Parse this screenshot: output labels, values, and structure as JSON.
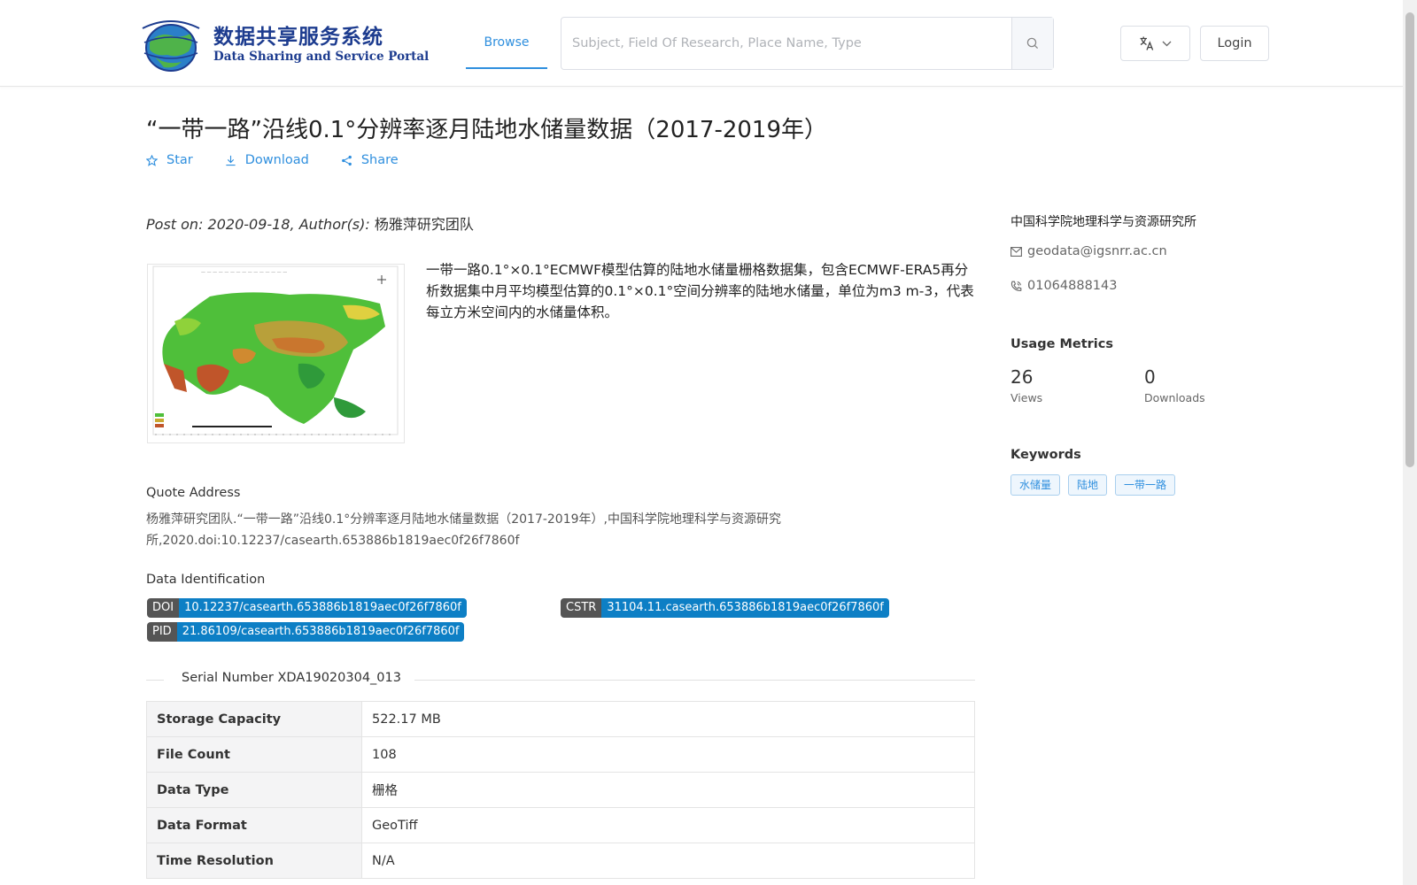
{
  "header": {
    "logo_cn": "数据共享服务系统",
    "logo_en": "Data Sharing and Service Portal",
    "nav_browse": "Browse",
    "search_placeholder": "Subject, Field Of Research, Place Name, Type",
    "login_label": "Login"
  },
  "dataset": {
    "title": "“一带一路”沿线0.1°分辨率逐月陆地水储量数据（2017-2019年）",
    "actions": {
      "star": "Star",
      "download": "Download",
      "share": "Share"
    },
    "post_on": "Post on: 2020-09-18, Author(s):",
    "authors": "杨雅萍研究团队",
    "abstract": "一带一路0.1°×0.1°ECMWF模型估算的陆地水储量栅格数据集，包含ECMWF-ERA5再分析数据集中月平均模型估算的0.1°×0.1°空间分辨率的陆地水储量，单位为m3 m-3，代表每立方米空间内的水储量体积。"
  },
  "quote": {
    "label": "Quote Address",
    "text": "杨雅萍研究团队.“一带一路”沿线0.1°分辨率逐月陆地水储量数据（2017-2019年）,中国科学院地理科学与资源研究所,2020.doi:10.12237/casearth.653886b1819aec0f26f7860f"
  },
  "identification": {
    "label": "Data Identification",
    "doi_key": "DOI",
    "doi_value": "10.12237/casearth.653886b1819aec0f26f7860f",
    "cstr_key": "CSTR",
    "cstr_value": "31104.11.casearth.653886b1819aec0f26f7860f",
    "pid_key": "PID",
    "pid_value": "21.86109/casearth.653886b1819aec0f26f7860f"
  },
  "serial_number": "Serial Number XDA19020304_013",
  "metadata_table": [
    {
      "key": "Storage Capacity",
      "value": "522.17 MB"
    },
    {
      "key": "File Count",
      "value": "108"
    },
    {
      "key": "Data Type",
      "value": "栅格"
    },
    {
      "key": "Data Format",
      "value": "GeoTiff"
    },
    {
      "key": "Time Resolution",
      "value": "N/A"
    }
  ],
  "sidebar": {
    "organization": "中国科学院地理科学与资源研究所",
    "email": "geodata@igsnrr.ac.cn",
    "phone": "01064888143",
    "usage_heading": "Usage Metrics",
    "views_value": "26",
    "views_label": "Views",
    "downloads_value": "0",
    "downloads_label": "Downloads",
    "keywords_heading": "Keywords",
    "keywords": [
      "水储量",
      "陆地",
      "一带一路"
    ]
  },
  "colors": {
    "accent": "#2f8fde",
    "badge_value": "#0d7fc5",
    "badge_key": "#555555"
  }
}
